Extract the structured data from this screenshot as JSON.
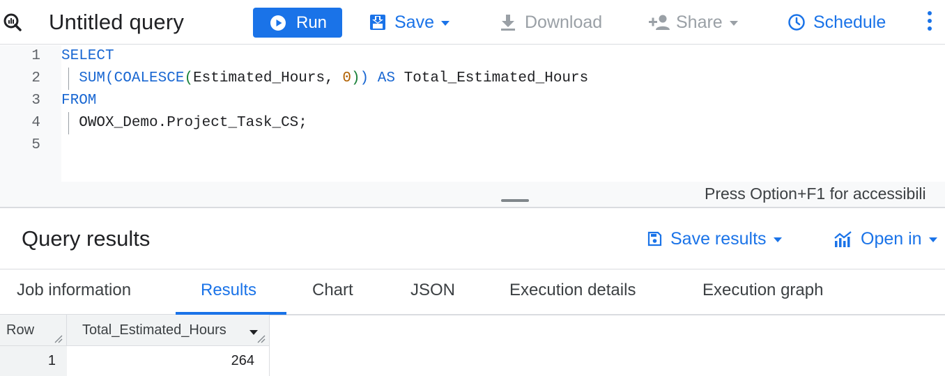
{
  "toolbar": {
    "title": "Untitled query",
    "run_label": "Run",
    "save_label": "Save",
    "download_label": "Download",
    "share_label": "Share",
    "schedule_label": "Schedule"
  },
  "editor": {
    "line_numbers": [
      "1",
      "2",
      "3",
      "4",
      "5"
    ],
    "lines": [
      "SELECT",
      "  SUM(COALESCE(Estimated_Hours, 0)) AS Total_Estimated_Hours",
      "FROM",
      "  OWOX_Demo.Project_Task_CS;",
      ""
    ],
    "tokens": {
      "select": "SELECT",
      "sum": "SUM",
      "open1": "(",
      "coalesce": "COALESCE",
      "open2": "(",
      "arg": "Estimated_Hours, ",
      "zero": "0",
      "close2": ")",
      "close1": ")",
      "as": "AS",
      "alias": "Total_Estimated_Hours",
      "from": "FROM",
      "table": "OWOX_Demo.Project_Task_CS;"
    },
    "status_text": "Press Option+F1 for accessibili"
  },
  "results": {
    "title": "Query results",
    "save_results_label": "Save results",
    "open_in_label": "Open in",
    "tabs": [
      {
        "label": "Job information",
        "active": false
      },
      {
        "label": "Results",
        "active": true
      },
      {
        "label": "Chart",
        "active": false
      },
      {
        "label": "JSON",
        "active": false
      },
      {
        "label": "Execution details",
        "active": false
      },
      {
        "label": "Execution graph",
        "active": false
      }
    ],
    "table": {
      "columns": [
        "Row",
        "Total_Estimated_Hours"
      ],
      "rows": [
        [
          "1",
          "264"
        ]
      ]
    }
  },
  "colors": {
    "accent": "#1a73e8",
    "keyword": "#1967d2",
    "paren": "#188038",
    "number": "#b06000",
    "disabled": "#9aa0a6"
  },
  "icons": [
    "query-icon",
    "play-icon",
    "save-icon",
    "download-icon",
    "share-person-icon",
    "clock-icon",
    "more-vert-icon",
    "save-results-icon",
    "chart-icon"
  ]
}
